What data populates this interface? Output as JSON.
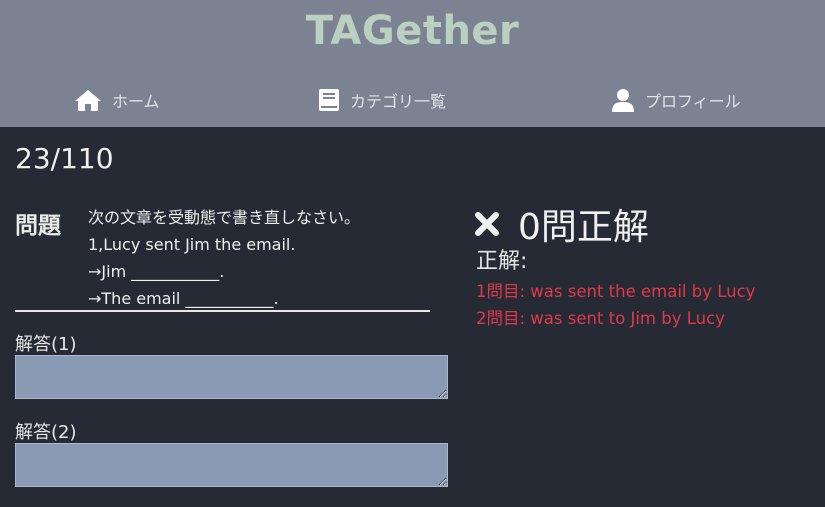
{
  "header": {
    "brand": "TAGether",
    "nav": [
      {
        "label": "ホーム",
        "icon": "home-icon"
      },
      {
        "label": "カテゴリ一覧",
        "icon": "book-icon"
      },
      {
        "label": "プロフィール",
        "icon": "user-icon"
      }
    ]
  },
  "progress": {
    "text": "23/110"
  },
  "question": {
    "label": "問題",
    "lines": [
      "次の文章を受動態で書き直しなさい。",
      "1,Lucy sent Jim the email.",
      "→Jim ___________.",
      "→The email ___________."
    ]
  },
  "answers": [
    {
      "label": "解答(1)",
      "value": ""
    },
    {
      "label": "解答(2)",
      "value": ""
    }
  ],
  "result": {
    "icon": "cross-icon",
    "text": "0問正解",
    "correct_label": "正解:",
    "correct_answers": [
      "1問目: was sent the email by Lucy",
      "2問目: was sent to Jim by Lucy"
    ]
  },
  "colors": {
    "header_bg": "#7b8393",
    "page_bg": "#252a34",
    "brand": "#bcd0c1",
    "answer_red": "#e0394a",
    "input_bg": "#8a9ab4"
  }
}
